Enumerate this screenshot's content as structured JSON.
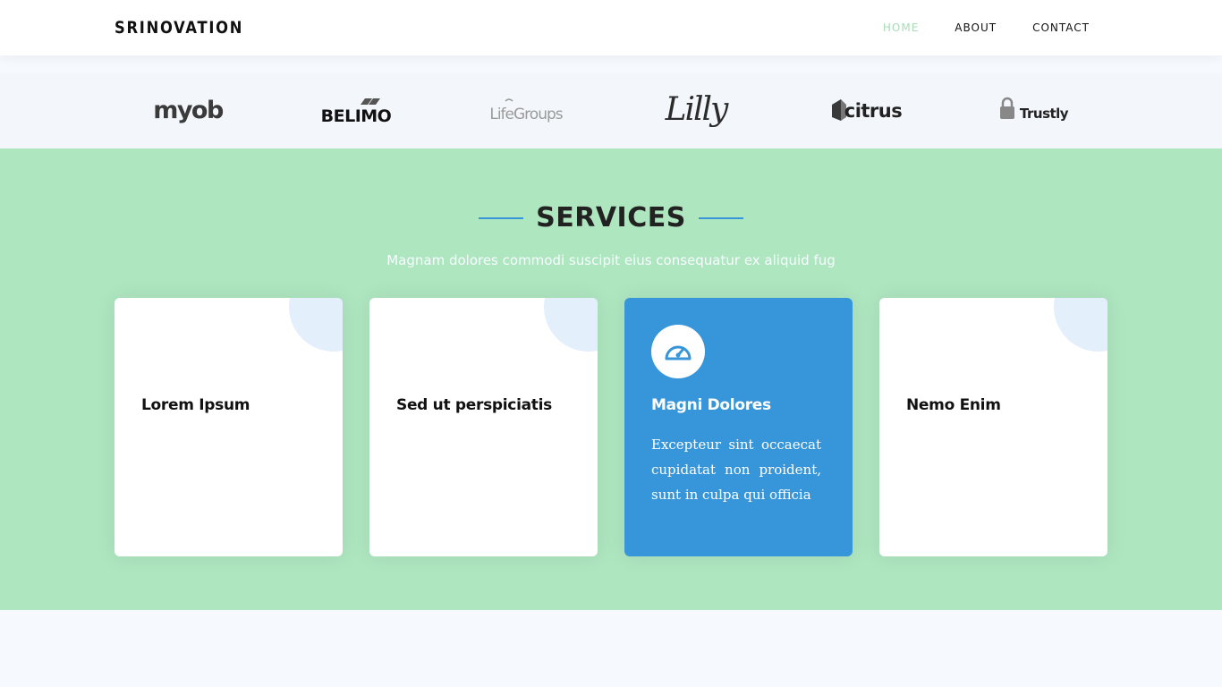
{
  "header": {
    "logo": "SRINOVATION",
    "nav": [
      "HOME",
      "ABOUT",
      "CONTACT"
    ],
    "active_nav": "HOME"
  },
  "clients": [
    "myob",
    "BELIMO",
    "LifeGroups",
    "Lilly",
    "citrus",
    "Trustly"
  ],
  "services": {
    "title": "SERVICES",
    "subtitle": "Magnam dolores commodi suscipit eius consequatur ex aliquid fug",
    "cards": [
      {
        "title": "Lorem Ipsum",
        "text": ""
      },
      {
        "title": "Sed ut perspiciatis",
        "text": ""
      },
      {
        "title": "Magni Dolores",
        "text": "Excepteur sint occaecat cupidatat non proident, sunt in culpa qui officia",
        "icon": "dashboard-icon",
        "active": true
      },
      {
        "title": "Nemo Enim",
        "text": ""
      }
    ]
  },
  "colors": {
    "accent": "#3796d9",
    "section_bg": "#aee6c0",
    "nav_active": "#a7dcb7"
  }
}
